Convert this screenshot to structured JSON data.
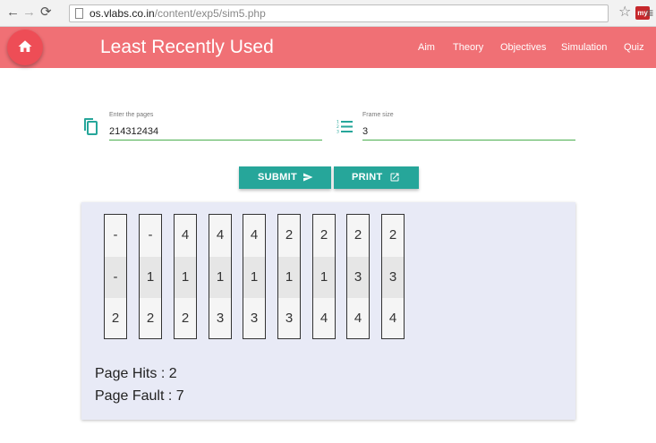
{
  "browser": {
    "url_host": "os.vlabs.co.in",
    "url_path": "/content/exp5/sim5.php",
    "extension_label": "my"
  },
  "appbar": {
    "title": "Least Recently Used",
    "nav": [
      "Aim",
      "Theory",
      "Objectives",
      "Simulation",
      "Quiz"
    ],
    "color": "#f07075"
  },
  "form": {
    "pages_label": "Enter the pages",
    "pages_value": "214312434",
    "frame_label": "Frame size",
    "frame_value": "3"
  },
  "buttons": {
    "submit": "SUBMIT",
    "print": "PRINT",
    "color": "#26a69a"
  },
  "frames": [
    [
      "-",
      "-",
      "2"
    ],
    [
      "-",
      "1",
      "2"
    ],
    [
      "4",
      "1",
      "2"
    ],
    [
      "4",
      "1",
      "3"
    ],
    [
      "4",
      "1",
      "3"
    ],
    [
      "2",
      "1",
      "3"
    ],
    [
      "2",
      "1",
      "4"
    ],
    [
      "2",
      "3",
      "4"
    ],
    [
      "2",
      "3",
      "4"
    ]
  ],
  "results": {
    "hits": "Page Hits : 2",
    "faults": "Page Fault : 7"
  }
}
